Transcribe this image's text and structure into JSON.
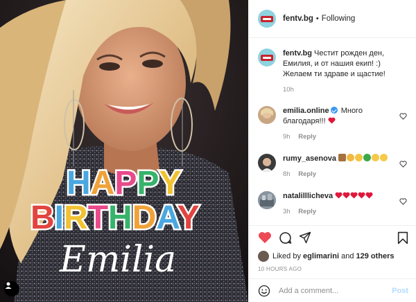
{
  "photo": {
    "headline_1": "HAPPY",
    "headline_2": "BIRTHDAY",
    "script_name": "Emilia"
  },
  "header": {
    "username": "fentv.bg",
    "separator": "•",
    "follow_label": "Following"
  },
  "caption": {
    "username": "fentv.bg",
    "text": "Честит рожден ден, Емилия, и от нашия екип! :) Желаем ти здраве и щастие!",
    "time": "10h"
  },
  "comments": [
    {
      "username": "emilia.online",
      "text": "Много благодаря!!!",
      "time": "9h",
      "reply": "Reply",
      "verified": true
    },
    {
      "username": "rumy_asenova",
      "text": "",
      "time": "8h",
      "reply": "Reply"
    },
    {
      "username": "natalilllicheva",
      "text": "",
      "time": "3h",
      "reply": "Reply"
    }
  ],
  "likes": {
    "prefix": "Liked by",
    "first_user": "eglimarini",
    "conjunction": "and",
    "others": "129 others"
  },
  "timestamp": "10 HOURS AGO",
  "composer": {
    "placeholder": "Add a comment...",
    "post_label": "Post"
  },
  "icons": {
    "like": "heart-icon",
    "comment": "comment-icon",
    "share": "share-icon",
    "save": "bookmark-icon",
    "emoji": "smiley-icon"
  },
  "colors": {
    "liked_heart": "#ed4956",
    "verified": "#3897f0",
    "post_disabled": "#b3dbff",
    "muted_text": "#8e8e8e"
  }
}
